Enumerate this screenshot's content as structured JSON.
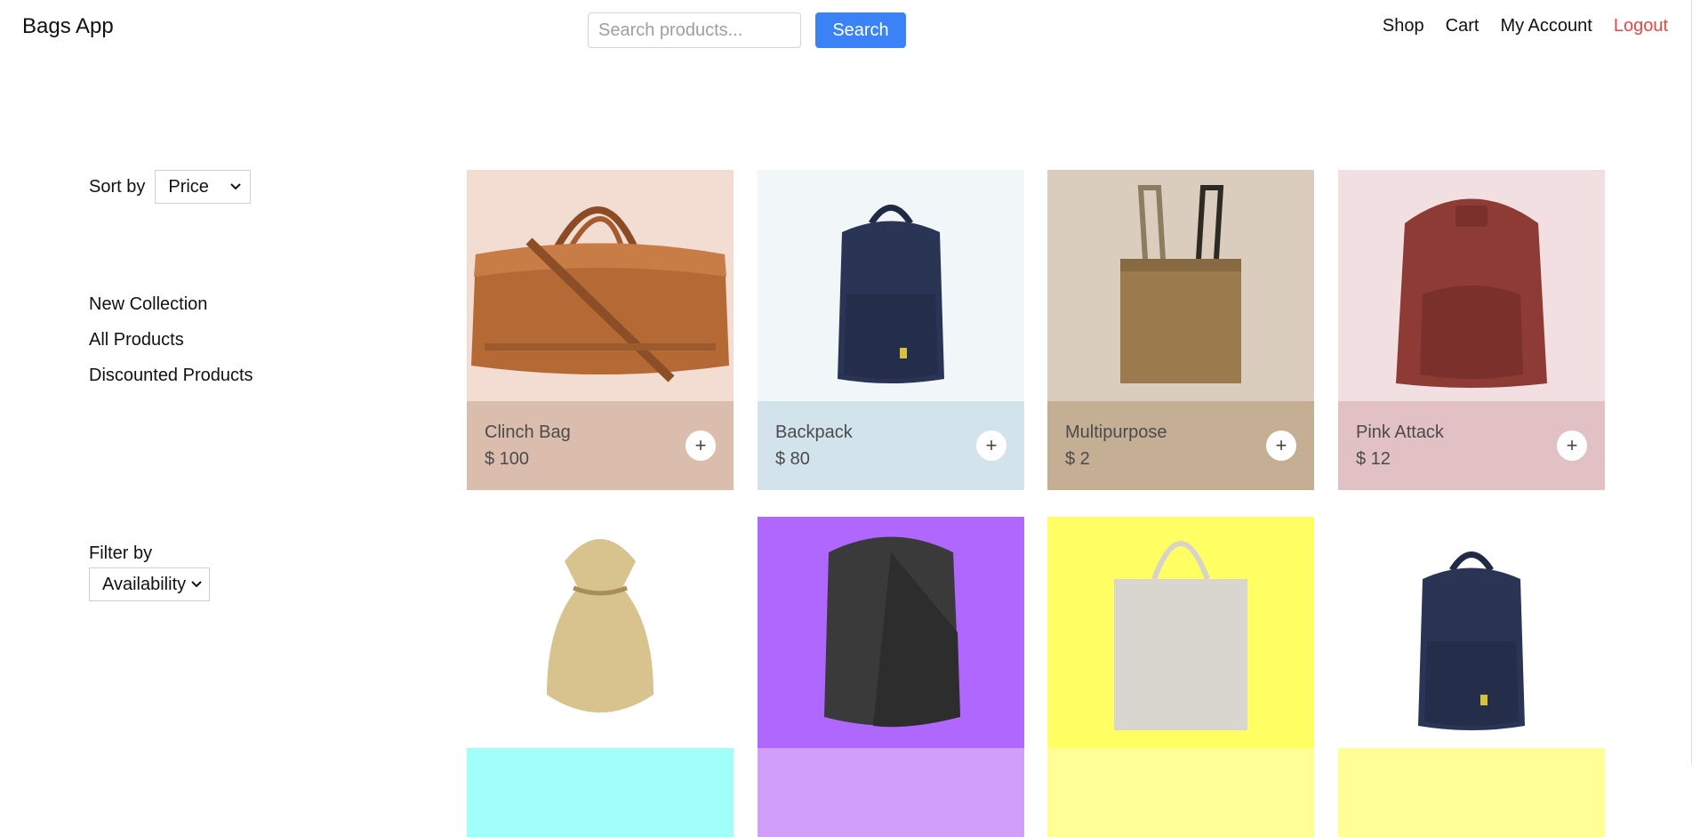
{
  "header": {
    "brand": "Bags App",
    "search_placeholder": "Search products...",
    "search_label": "Search",
    "nav": {
      "shop": "Shop",
      "cart": "Cart",
      "account": "My Account",
      "logout": "Logout"
    }
  },
  "sidebar": {
    "sort_label": "Sort by",
    "sort_value": "Price",
    "collections": [
      "New Collection",
      "All Products",
      "Discounted Products"
    ],
    "filter_label": "Filter by",
    "filter_value": "Availability"
  },
  "products": [
    {
      "name": "Clinch Bag",
      "price": "$ 100",
      "image": "duffel-bag",
      "bg": "#f3ddd3",
      "panel": "#dbbdae"
    },
    {
      "name": "Backpack",
      "price": "$ 80",
      "image": "navy-backpack",
      "bg": "#f1f6f8",
      "panel": "#d3e3ec"
    },
    {
      "name": "Multipurpose",
      "price": "$ 2",
      "image": "tote-bag",
      "bg": "#dbcdbd",
      "panel": "#c4ae94"
    },
    {
      "name": "Pink Attack",
      "price": "$ 12",
      "image": "leather-backpack",
      "bg": "#f2dfe1",
      "panel": "#e1c1c4"
    },
    {
      "name": "",
      "price": "",
      "image": "burlap-sack",
      "bg": "#ffffff",
      "panel": "#a0fff9"
    },
    {
      "name": "",
      "price": "",
      "image": "grey-backpack",
      "bg": "#b067fe",
      "panel": "#d19ef9"
    },
    {
      "name": "",
      "price": "",
      "image": "canvas-tote",
      "bg": "#ffff63",
      "panel": "#ffff96"
    },
    {
      "name": "",
      "price": "",
      "image": "navy-backpack",
      "bg": "#ffffff",
      "panel": "#ffff96"
    }
  ]
}
